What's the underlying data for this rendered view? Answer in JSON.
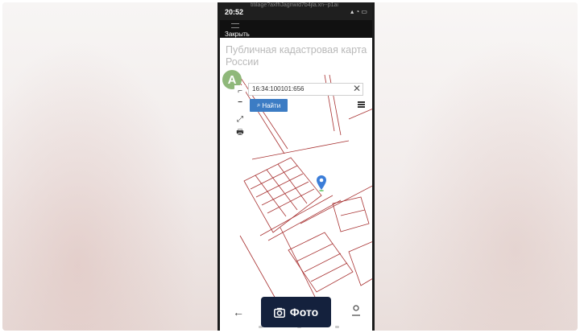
{
  "status_bar": {
    "time": "20:52",
    "url_fragment": "titilage?axfhJagnwid7b4jla.xn--p1ai"
  },
  "webview": {
    "close_label": "Закрыть",
    "page_title": "Публичная кадастровая карта России"
  },
  "map": {
    "search_value": "16:34:100101:656",
    "find_button_label": "Найти",
    "marker_letter": "A"
  },
  "overlay": {
    "photo_button_label": "Фото"
  },
  "colors": {
    "parcel_lines": "#a83232",
    "find_button": "#3c7cc4",
    "photo_button": "#14213d",
    "marker_circle": "#8fb87a",
    "pin": "#3b7dd8"
  }
}
